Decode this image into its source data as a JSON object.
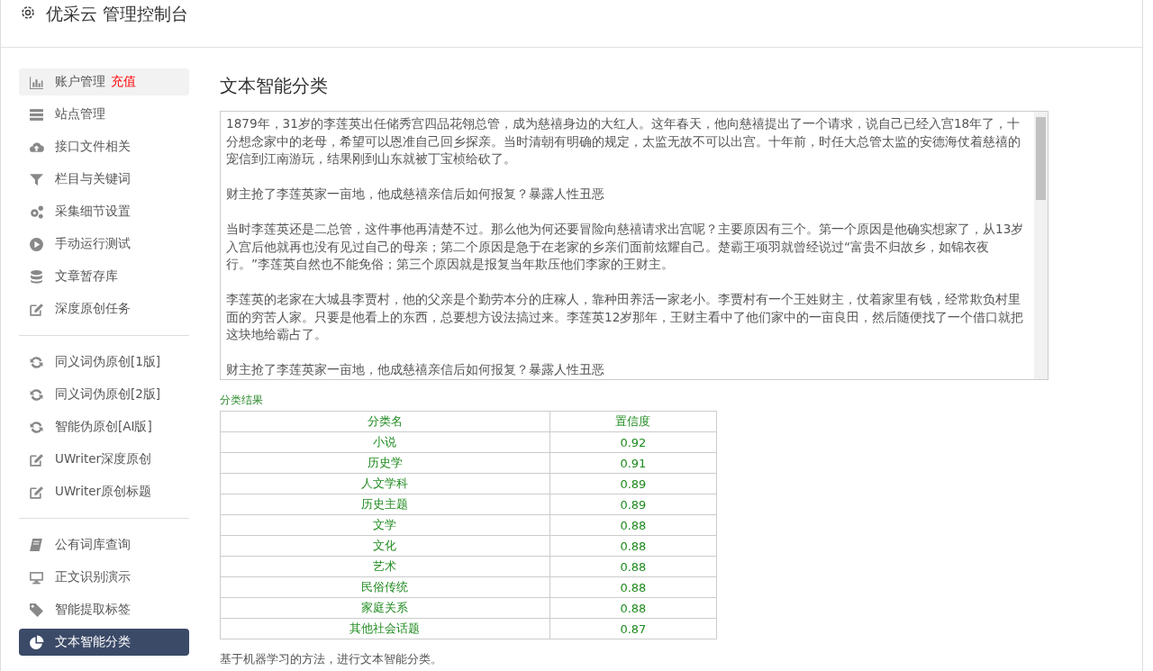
{
  "header": {
    "title": "优采云 管理控制台"
  },
  "sidebar": {
    "groups": [
      {
        "items": [
          {
            "label": "账户管理",
            "badge": "充值",
            "highlighted": true,
            "selected": false
          },
          {
            "label": "站点管理",
            "highlighted": false,
            "selected": false
          },
          {
            "label": "接口文件相关",
            "highlighted": false,
            "selected": false
          },
          {
            "label": "栏目与关键词",
            "highlighted": false,
            "selected": false
          },
          {
            "label": "采集细节设置",
            "highlighted": false,
            "selected": false
          },
          {
            "label": "手动运行测试",
            "highlighted": false,
            "selected": false
          },
          {
            "label": "文章暂存库",
            "highlighted": false,
            "selected": false
          },
          {
            "label": "深度原创任务",
            "highlighted": false,
            "selected": false
          }
        ]
      },
      {
        "items": [
          {
            "label": "同义词伪原创[1版]",
            "highlighted": false,
            "selected": false
          },
          {
            "label": "同义词伪原创[2版]",
            "highlighted": false,
            "selected": false
          },
          {
            "label": "智能伪原创[AI版]",
            "highlighted": false,
            "selected": false
          },
          {
            "label": "UWriter深度原创",
            "highlighted": false,
            "selected": false
          },
          {
            "label": "UWriter原创标题",
            "highlighted": false,
            "selected": false
          }
        ]
      },
      {
        "items": [
          {
            "label": "公有词库查询",
            "highlighted": false,
            "selected": false
          },
          {
            "label": "正文识别演示",
            "highlighted": false,
            "selected": false
          },
          {
            "label": "智能提取标签",
            "highlighted": false,
            "selected": false
          },
          {
            "label": "文本智能分类",
            "highlighted": false,
            "selected": true
          }
        ]
      }
    ]
  },
  "main": {
    "title": "文本智能分类",
    "input_text": [
      "1879年，31岁的李莲英出任储秀宫四品花翎总管，成为慈禧身边的大红人。这年春天，他向慈禧提出了一个请求，说自己已经入宫18年了，十分想念家中的老母，希望可以恩准自己回乡探亲。当时清朝有明确的规定，太监无故不可以出宫。十年前，时任大总管太监的安德海仗着慈禧的宠信到江南游玩，结果刚到山东就被丁宝桢给砍了。",
      "财主抢了李莲英家一亩地，他成慈禧亲信后如何报复？暴露人性丑恶",
      "当时李莲英还是二总管，这件事他再清楚不过。那么他为何还要冒险向慈禧请求出宫呢？主要原因有三个。第一个原因是他确实想家了，从13岁入宫后他就再也没有见过自己的母亲；第二个原因是急于在老家的乡亲们面前炫耀自己。楚霸王项羽就曾经说过“富贵不归故乡，如锦衣夜行。”李莲英自然也不能免俗；第三个原因就是报复当年欺压他们李家的王财主。",
      "李莲英的老家在大城县李贾村，他的父亲是个勤劳本分的庄稼人，靠种田养活一家老小。李贾村有一个王姓财主，仗着家里有钱，经常欺负村里面的穷苦人家。只要是他看上的东西，总要想方设法搞过来。李莲英12岁那年，王财主看中了他们家中的一亩良田，然后随便找了一个借口就把这块地给霸占了。",
      "财主抢了李莲英家一亩地，他成慈禧亲信后如何报复？暴露人性丑恶"
    ],
    "result_label": "分类结果",
    "table": {
      "columns": [
        "分类名",
        "置信度"
      ],
      "rows": [
        [
          "小说",
          "0.92"
        ],
        [
          "历史学",
          "0.91"
        ],
        [
          "人文学科",
          "0.89"
        ],
        [
          "历史主题",
          "0.89"
        ],
        [
          "文学",
          "0.88"
        ],
        [
          "文化",
          "0.88"
        ],
        [
          "艺术",
          "0.88"
        ],
        [
          "民俗传统",
          "0.88"
        ],
        [
          "家庭关系",
          "0.88"
        ],
        [
          "其他社会话题",
          "0.87"
        ]
      ]
    },
    "description": "基于机器学习的方法，进行文本智能分类。"
  }
}
